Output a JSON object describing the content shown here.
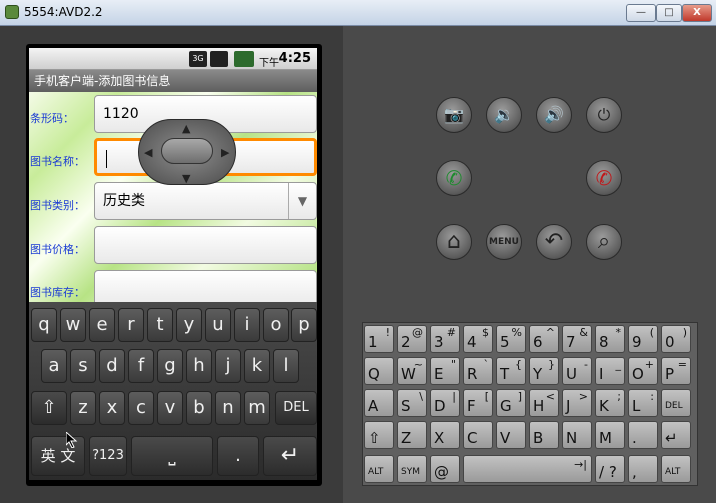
{
  "window": {
    "title": "5554:AVD2.2",
    "minimize": "—",
    "maximize": "□",
    "close": "X"
  },
  "status_bar": {
    "network": "3G",
    "ampm": "下午",
    "time": "4:25"
  },
  "app": {
    "title": "手机客户端-添加图书信息",
    "fields": [
      {
        "label": "条形码：",
        "value": ""
      },
      {
        "label": "图书名称：",
        "value": ""
      },
      {
        "label": "图书类别：",
        "value": "历史类"
      },
      {
        "label": "图书价格：",
        "value": ""
      },
      {
        "label": "图书库存：",
        "value": ""
      }
    ],
    "barcode_value": "1120"
  },
  "soft_keyboard": {
    "row1": [
      "q",
      "w",
      "e",
      "r",
      "t",
      "y",
      "u",
      "i",
      "o",
      "p"
    ],
    "row2": [
      "a",
      "s",
      "d",
      "f",
      "g",
      "h",
      "j",
      "k",
      "l"
    ],
    "row3": [
      "z",
      "x",
      "c",
      "v",
      "b",
      "n",
      "m"
    ],
    "shift": "⇧",
    "delete": "DEL",
    "lang": "英 文",
    "sym": "?123",
    "space": "⎵",
    "dot": ".",
    "enter": "↵"
  },
  "hardware_buttons": {
    "camera": "📷",
    "vol_down": "🔉",
    "vol_up": "🔊",
    "power": "⏻",
    "call": "✆",
    "end": "✆",
    "home": "⌂",
    "menu": "MENU",
    "back": "↶",
    "search": "⌕"
  },
  "hw_keyboard": {
    "row1": [
      [
        "1",
        "!"
      ],
      [
        "2",
        "@"
      ],
      [
        "3",
        "#"
      ],
      [
        "4",
        "$"
      ],
      [
        "5",
        "%"
      ],
      [
        "6",
        "^"
      ],
      [
        "7",
        "&"
      ],
      [
        "8",
        "*"
      ],
      [
        "9",
        "("
      ],
      [
        "0",
        ")"
      ]
    ],
    "row2": [
      [
        "Q",
        ""
      ],
      [
        "W",
        "~"
      ],
      [
        "E",
        "\""
      ],
      [
        "R",
        "`"
      ],
      [
        "T",
        "{"
      ],
      [
        "Y",
        "}"
      ],
      [
        "U",
        "-"
      ],
      [
        "I",
        "_"
      ],
      [
        "O",
        "+"
      ],
      [
        "P",
        "="
      ]
    ],
    "row3": [
      [
        "A",
        ""
      ],
      [
        "S",
        "\\"
      ],
      [
        "D",
        "|"
      ],
      [
        "F",
        "["
      ],
      [
        "G",
        "]"
      ],
      [
        "H",
        "<"
      ],
      [
        "J",
        ">"
      ],
      [
        "K",
        ";"
      ],
      [
        "L",
        ":"
      ],
      [
        "DEL",
        ""
      ]
    ],
    "row4": [
      [
        "⇧",
        ""
      ],
      [
        "Z",
        ""
      ],
      [
        "X",
        ""
      ],
      [
        "C",
        ""
      ],
      [
        "V",
        ""
      ],
      [
        "B",
        ""
      ],
      [
        "N",
        ""
      ],
      [
        "M",
        ""
      ],
      [
        ".",
        ""
      ],
      [
        "↵",
        ""
      ]
    ],
    "row5": {
      "alt_left": "ALT",
      "sym": "SYM",
      "at": "@",
      "tab": "→|",
      "slash": "/ ?",
      "comma": ",",
      "alt_right": "ALT"
    }
  }
}
